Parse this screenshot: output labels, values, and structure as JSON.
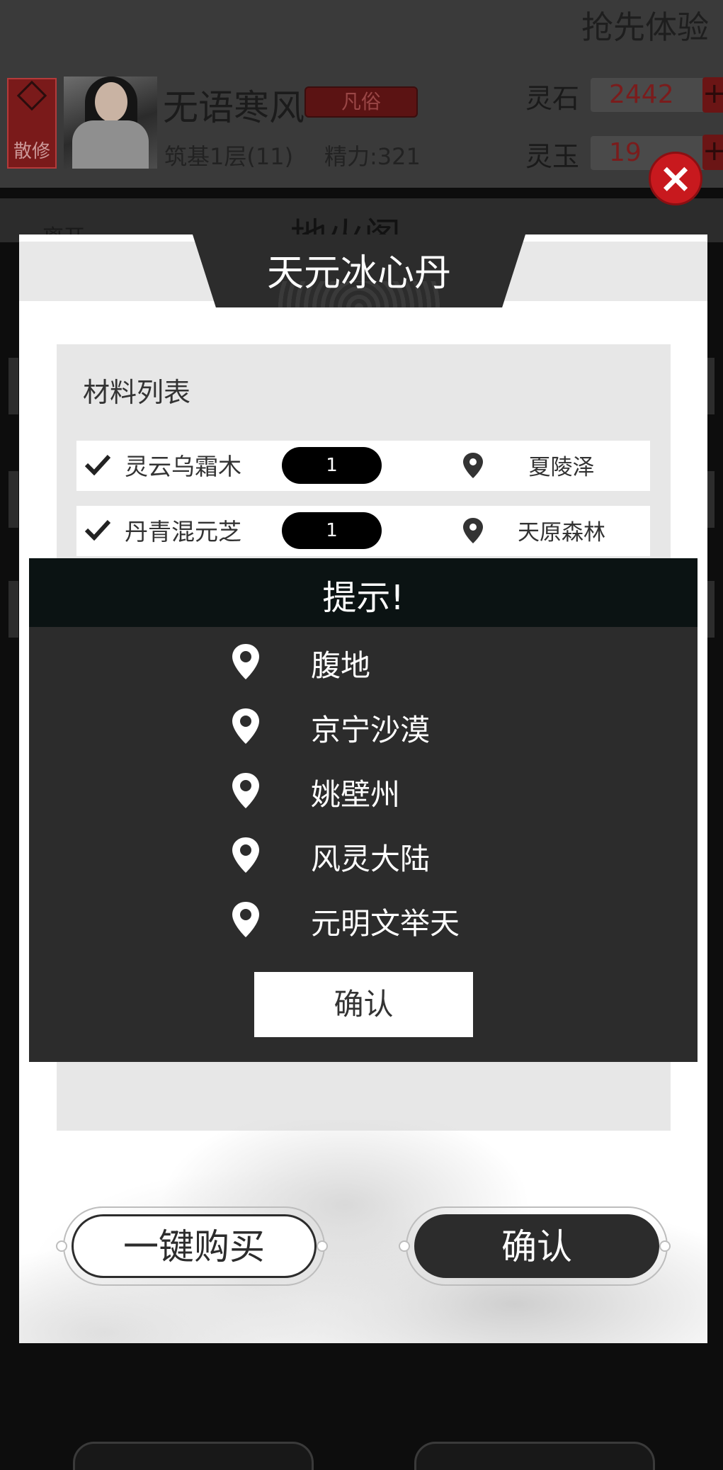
{
  "header": {
    "promo_text": "抢先体验",
    "sect_label": "散修",
    "player_name": "无语寒风",
    "rank": "凡俗",
    "realm": "筑基1层(11)",
    "energy": "精力:321",
    "currencies": [
      {
        "label": "灵石",
        "value": "2442"
      },
      {
        "label": "灵玉",
        "value": "19"
      }
    ]
  },
  "background": {
    "leave_label": "离开",
    "page_title": "地火阁"
  },
  "modal": {
    "title": "天元冰心丹",
    "materials_heading": "材料列表",
    "materials": [
      {
        "name": "灵云乌霜木",
        "qty": "1",
        "location": "夏陵泽"
      },
      {
        "name": "丹青混元芝",
        "qty": "1",
        "location": "天原森林"
      }
    ],
    "buy_all_label": "一键购买",
    "confirm_label": "确认",
    "close_icon": "close-icon"
  },
  "hint_dialog": {
    "title": "提示!",
    "locations": [
      "腹地",
      "京宁沙漠",
      "姚壁州",
      "风灵大陆",
      "元明文举天"
    ],
    "confirm_label": "确认"
  },
  "colors": {
    "modal_title_bg": "#2c2c2c",
    "hint_bg": "#2c2c2c",
    "hint_header_bg": "#0b1313",
    "close_red": "#c8191e",
    "currency_red": "#7a1c1c"
  }
}
